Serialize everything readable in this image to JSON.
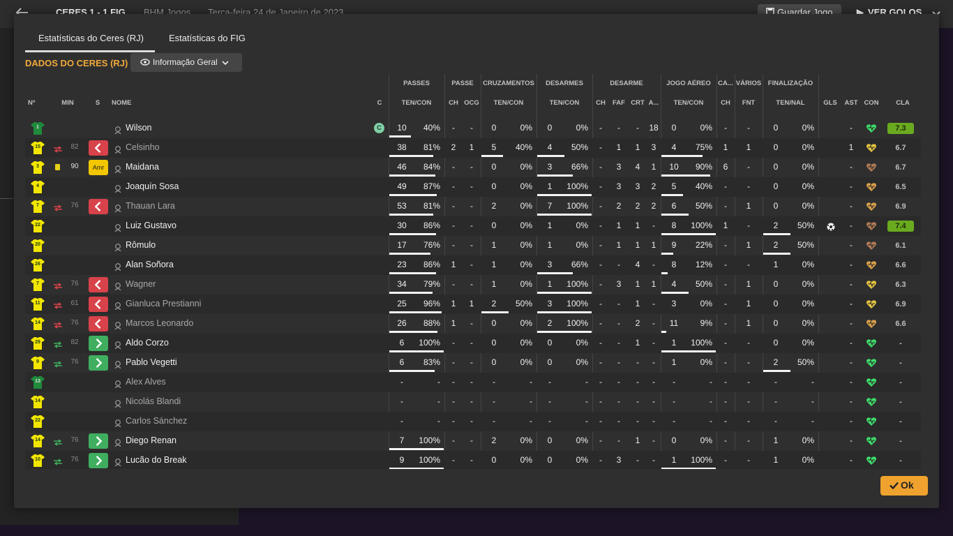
{
  "topbar": {
    "score_home": "CERES",
    "score": "1 - 1",
    "score_away": "FIG",
    "context": "BHM Jogos",
    "date": "Terça-feira 24 de Janeiro de 2023",
    "save_label": "Guardar Jogo",
    "goals_label": "VER GOLOS"
  },
  "tabs": [
    "Estatísticas do Ceres (RJ)",
    "Estatísticas do FIG"
  ],
  "section_title": "DADOS DO CERES (RJ)",
  "view_select": "Informação Geral",
  "group_headers": {
    "passes": "PASSES",
    "passe": "PASSE",
    "cruz": "CRUZAMENTOS",
    "desarmes": "DESARMES",
    "desarme": "DESARME",
    "aereo": "JOGO AÉREO",
    "ca": "CA...",
    "varios": "VÁRIOS",
    "final": "FINALIZAÇÃO"
  },
  "columns": {
    "num": "Nº",
    "min": "MIN",
    "s": "S",
    "name": "NOME",
    "c": "C",
    "pass_tc": "TEN/CON",
    "pass_ch": "CH",
    "pass_ocg": "OCG",
    "cruz_tc": "TEN/CON",
    "des_tc": "TEN/CON",
    "d_ch": "CH",
    "d_faf": "FAF",
    "d_crt": "CRT",
    "d_a": "A...",
    "aer_tc": "TEN/CON",
    "ca_ch": "CH",
    "fnt": "FNT",
    "fin_tn": "TEN/NAL",
    "gls": "GLS",
    "ast": "AST",
    "con": "CON",
    "cla": "CLA"
  },
  "players": [
    {
      "num": "1",
      "gk": true,
      "event": "",
      "min": "",
      "sub": "",
      "name": "Wilson",
      "dim": false,
      "captain": "C",
      "p": [
        "10",
        "40%"
      ],
      "pch": "-",
      "pocg": "-",
      "cr": [
        "0",
        "0%"
      ],
      "de": [
        "0",
        "0%"
      ],
      "dch": "-",
      "faf": "-",
      "crt": "-",
      "da": "18",
      "ae": [
        "0",
        "0%"
      ],
      "cach": "-",
      "fnt": "-",
      "fi": [
        "0",
        "0%"
      ],
      "gls": "",
      "ast": "-",
      "con": "green",
      "cla": "7.3",
      "hi": true
    },
    {
      "num": "15",
      "gk": false,
      "event": "out",
      "min": "82",
      "sub": "out",
      "name": "Celsinho",
      "dim": true,
      "captain": "",
      "p": [
        "38",
        "81%"
      ],
      "pch": "2",
      "pocg": "1",
      "cr": [
        "5",
        "40%"
      ],
      "de": [
        "4",
        "50%"
      ],
      "dch": "-",
      "faf": "1",
      "crt": "1",
      "da": "3",
      "ae": [
        "4",
        "75%"
      ],
      "cach": "1",
      "fnt": "1",
      "fi": [
        "0",
        "0%"
      ],
      "gls": "",
      "ast": "1",
      "con": "yellow",
      "cla": "6.7",
      "hi": false
    },
    {
      "num": "3",
      "gk": false,
      "event": "card",
      "min": "90",
      "sub": "amr",
      "name": "Maidana",
      "dim": false,
      "captain": "",
      "p": [
        "46",
        "84%"
      ],
      "pch": "-",
      "pocg": "-",
      "cr": [
        "0",
        "0%"
      ],
      "de": [
        "3",
        "66%"
      ],
      "dch": "-",
      "faf": "3",
      "crt": "4",
      "da": "1",
      "ae": [
        "10",
        "90%"
      ],
      "cach": "6",
      "fnt": "-",
      "fi": [
        "0",
        "0%"
      ],
      "gls": "",
      "ast": "-",
      "con": "orange",
      "cla": "6.7",
      "hi": false
    },
    {
      "num": "4",
      "gk": false,
      "event": "",
      "min": "",
      "sub": "",
      "name": "Joaquín Sosa",
      "dim": false,
      "captain": "",
      "p": [
        "49",
        "87%"
      ],
      "pch": "-",
      "pocg": "-",
      "cr": [
        "0",
        "0%"
      ],
      "de": [
        "1",
        "100%"
      ],
      "dch": "-",
      "faf": "3",
      "crt": "3",
      "da": "2",
      "ae": [
        "5",
        "40%"
      ],
      "cach": "-",
      "fnt": "-",
      "fi": [
        "0",
        "0%"
      ],
      "gls": "",
      "ast": "-",
      "con": "amber",
      "cla": "6.5",
      "hi": false
    },
    {
      "num": "7",
      "gk": false,
      "event": "out",
      "min": "76",
      "sub": "out",
      "name": "Thauan Lara",
      "dim": true,
      "captain": "",
      "p": [
        "53",
        "81%"
      ],
      "pch": "-",
      "pocg": "-",
      "cr": [
        "2",
        "0%"
      ],
      "de": [
        "7",
        "100%"
      ],
      "dch": "-",
      "faf": "2",
      "crt": "2",
      "da": "2",
      "ae": [
        "6",
        "50%"
      ],
      "cach": "-",
      "fnt": "1",
      "fi": [
        "0",
        "0%"
      ],
      "gls": "",
      "ast": "-",
      "con": "amber",
      "cla": "6.9",
      "hi": false
    },
    {
      "num": "22",
      "gk": false,
      "event": "",
      "min": "",
      "sub": "",
      "name": "Luiz Gustavo",
      "dim": false,
      "captain": "",
      "p": [
        "30",
        "86%"
      ],
      "pch": "-",
      "pocg": "-",
      "cr": [
        "0",
        "0%"
      ],
      "de": [
        "1",
        "0%"
      ],
      "dch": "-",
      "faf": "1",
      "crt": "1",
      "da": "-",
      "ae": [
        "8",
        "100%"
      ],
      "cach": "1",
      "fnt": "-",
      "fi": [
        "2",
        "50%"
      ],
      "gls": "ball",
      "ast": "-",
      "con": "orange",
      "cla": "7.4",
      "hi": true
    },
    {
      "num": "20",
      "gk": false,
      "event": "",
      "min": "",
      "sub": "",
      "name": "Rômulo",
      "dim": false,
      "captain": "",
      "p": [
        "17",
        "76%"
      ],
      "pch": "-",
      "pocg": "-",
      "cr": [
        "1",
        "0%"
      ],
      "de": [
        "1",
        "0%"
      ],
      "dch": "-",
      "faf": "1",
      "crt": "1",
      "da": "1",
      "ae": [
        "9",
        "22%"
      ],
      "cach": "-",
      "fnt": "1",
      "fi": [
        "2",
        "50%"
      ],
      "gls": "",
      "ast": "-",
      "con": "orange",
      "cla": "6.1",
      "hi": false
    },
    {
      "num": "26",
      "gk": false,
      "event": "",
      "min": "",
      "sub": "",
      "name": "Alan Soñora",
      "dim": false,
      "captain": "",
      "p": [
        "23",
        "86%"
      ],
      "pch": "1",
      "pocg": "-",
      "cr": [
        "1",
        "0%"
      ],
      "de": [
        "3",
        "66%"
      ],
      "dch": "-",
      "faf": "-",
      "crt": "4",
      "da": "-",
      "ae": [
        "8",
        "12%"
      ],
      "cach": "-",
      "fnt": "-",
      "fi": [
        "1",
        "0%"
      ],
      "gls": "",
      "ast": "-",
      "con": "amber",
      "cla": "6.6",
      "hi": false
    },
    {
      "num": "7",
      "gk": false,
      "event": "out",
      "min": "76",
      "sub": "out",
      "name": "Wagner",
      "dim": true,
      "captain": "",
      "p": [
        "34",
        "79%"
      ],
      "pch": "-",
      "pocg": "-",
      "cr": [
        "1",
        "0%"
      ],
      "de": [
        "1",
        "100%"
      ],
      "dch": "-",
      "faf": "3",
      "crt": "1",
      "da": "1",
      "ae": [
        "4",
        "50%"
      ],
      "cach": "-",
      "fnt": "1",
      "fi": [
        "0",
        "0%"
      ],
      "gls": "",
      "ast": "-",
      "con": "yellow",
      "cla": "6.3",
      "hi": false
    },
    {
      "num": "11",
      "gk": false,
      "event": "out",
      "min": "61",
      "sub": "out",
      "name": "Gianluca Prestianni",
      "dim": true,
      "captain": "",
      "p": [
        "25",
        "96%"
      ],
      "pch": "1",
      "pocg": "1",
      "cr": [
        "2",
        "50%"
      ],
      "de": [
        "3",
        "100%"
      ],
      "dch": "-",
      "faf": "-",
      "crt": "1",
      "da": "-",
      "ae": [
        "3",
        "0%"
      ],
      "cach": "-",
      "fnt": "1",
      "fi": [
        "0",
        "0%"
      ],
      "gls": "",
      "ast": "-",
      "con": "yellow",
      "cla": "6.9",
      "hi": false
    },
    {
      "num": "14",
      "gk": false,
      "event": "out",
      "min": "76",
      "sub": "out",
      "name": "Marcos Leonardo",
      "dim": true,
      "captain": "",
      "p": [
        "26",
        "88%"
      ],
      "pch": "1",
      "pocg": "-",
      "cr": [
        "0",
        "0%"
      ],
      "de": [
        "2",
        "100%"
      ],
      "dch": "-",
      "faf": "-",
      "crt": "2",
      "da": "-",
      "ae": [
        "11",
        "9%"
      ],
      "cach": "-",
      "fnt": "1",
      "fi": [
        "0",
        "0%"
      ],
      "gls": "",
      "ast": "-",
      "con": "amber",
      "cla": "6.6",
      "hi": false
    },
    {
      "num": "29",
      "gk": false,
      "event": "in",
      "min": "82",
      "sub": "in",
      "name": "Aldo Corzo",
      "dim": false,
      "captain": "",
      "p": [
        "6",
        "100%"
      ],
      "pch": "-",
      "pocg": "-",
      "cr": [
        "0",
        "0%"
      ],
      "de": [
        "0",
        "0%"
      ],
      "dch": "-",
      "faf": "-",
      "crt": "1",
      "da": "-",
      "ae": [
        "1",
        "100%"
      ],
      "cach": "-",
      "fnt": "-",
      "fi": [
        "0",
        "0%"
      ],
      "gls": "",
      "ast": "-",
      "con": "green",
      "cla": "-",
      "hi": false
    },
    {
      "num": "9",
      "gk": false,
      "event": "in",
      "min": "76",
      "sub": "in",
      "name": "Pablo Vegetti",
      "dim": false,
      "captain": "",
      "p": [
        "6",
        "83%"
      ],
      "pch": "-",
      "pocg": "-",
      "cr": [
        "0",
        "0%"
      ],
      "de": [
        "0",
        "0%"
      ],
      "dch": "-",
      "faf": "-",
      "crt": "-",
      "da": "-",
      "ae": [
        "1",
        "0%"
      ],
      "cach": "-",
      "fnt": "-",
      "fi": [
        "2",
        "50%"
      ],
      "gls": "",
      "ast": "-",
      "con": "green",
      "cla": "-",
      "hi": false
    },
    {
      "num": "13",
      "gk": true,
      "event": "",
      "min": "",
      "sub": "",
      "name": "Alex Alves",
      "dim": true,
      "captain": "",
      "p": [
        "-",
        "-"
      ],
      "pch": "-",
      "pocg": "-",
      "cr": [
        "-",
        "-"
      ],
      "de": [
        "-",
        "-"
      ],
      "dch": "-",
      "faf": "-",
      "crt": "-",
      "da": "-",
      "ae": [
        "-",
        "-"
      ],
      "cach": "-",
      "fnt": "-",
      "fi": [
        "-",
        "-"
      ],
      "gls": "",
      "ast": "-",
      "con": "green",
      "cla": "-",
      "hi": false
    },
    {
      "num": "14",
      "gk": false,
      "event": "",
      "min": "",
      "sub": "",
      "name": "Nicolás Blandi",
      "dim": true,
      "captain": "",
      "p": [
        "-",
        "-"
      ],
      "pch": "-",
      "pocg": "-",
      "cr": [
        "-",
        "-"
      ],
      "de": [
        "-",
        "-"
      ],
      "dch": "-",
      "faf": "-",
      "crt": "-",
      "da": "-",
      "ae": [
        "-",
        "-"
      ],
      "cach": "-",
      "fnt": "-",
      "fi": [
        "-",
        "-"
      ],
      "gls": "",
      "ast": "-",
      "con": "green",
      "cla": "-",
      "hi": false
    },
    {
      "num": "22",
      "gk": false,
      "event": "",
      "min": "",
      "sub": "",
      "name": "Carlos Sánchez",
      "dim": true,
      "captain": "",
      "p": [
        "-",
        "-"
      ],
      "pch": "-",
      "pocg": "-",
      "cr": [
        "-",
        "-"
      ],
      "de": [
        "-",
        "-"
      ],
      "dch": "-",
      "faf": "-",
      "crt": "-",
      "da": "-",
      "ae": [
        "-",
        "-"
      ],
      "cach": "-",
      "fnt": "-",
      "fi": [
        "-",
        "-"
      ],
      "gls": "",
      "ast": "-",
      "con": "green",
      "cla": "-",
      "hi": false
    },
    {
      "num": "14",
      "gk": false,
      "event": "in",
      "min": "76",
      "sub": "in",
      "name": "Diego Renan",
      "dim": false,
      "captain": "",
      "p": [
        "7",
        "100%"
      ],
      "pch": "-",
      "pocg": "-",
      "cr": [
        "2",
        "0%"
      ],
      "de": [
        "0",
        "0%"
      ],
      "dch": "-",
      "faf": "-",
      "crt": "1",
      "da": "-",
      "ae": [
        "0",
        "0%"
      ],
      "cach": "-",
      "fnt": "-",
      "fi": [
        "1",
        "0%"
      ],
      "gls": "",
      "ast": "-",
      "con": "green",
      "cla": "-",
      "hi": false
    },
    {
      "num": "10",
      "gk": false,
      "event": "in",
      "min": "76",
      "sub": "in",
      "name": "Lucão do Break",
      "dim": false,
      "captain": "",
      "p": [
        "9",
        "100%"
      ],
      "pch": "-",
      "pocg": "-",
      "cr": [
        "0",
        "0%"
      ],
      "de": [
        "0",
        "0%"
      ],
      "dch": "-",
      "faf": "3",
      "crt": "-",
      "da": "-",
      "ae": [
        "1",
        "100%"
      ],
      "cach": "-",
      "fnt": "-",
      "fi": [
        "1",
        "0%"
      ],
      "gls": "",
      "ast": "-",
      "con": "green",
      "cla": "-",
      "hi": false
    }
  ],
  "ok_label": "Ok",
  "colors": {
    "accent": "#f2a93b",
    "sub_out": "#d8424a",
    "sub_in": "#3fae5e",
    "rating_high": "#6aaa1f",
    "shirt_yellow": "#f2e600",
    "shirt_gk": "#1f8a3c"
  }
}
